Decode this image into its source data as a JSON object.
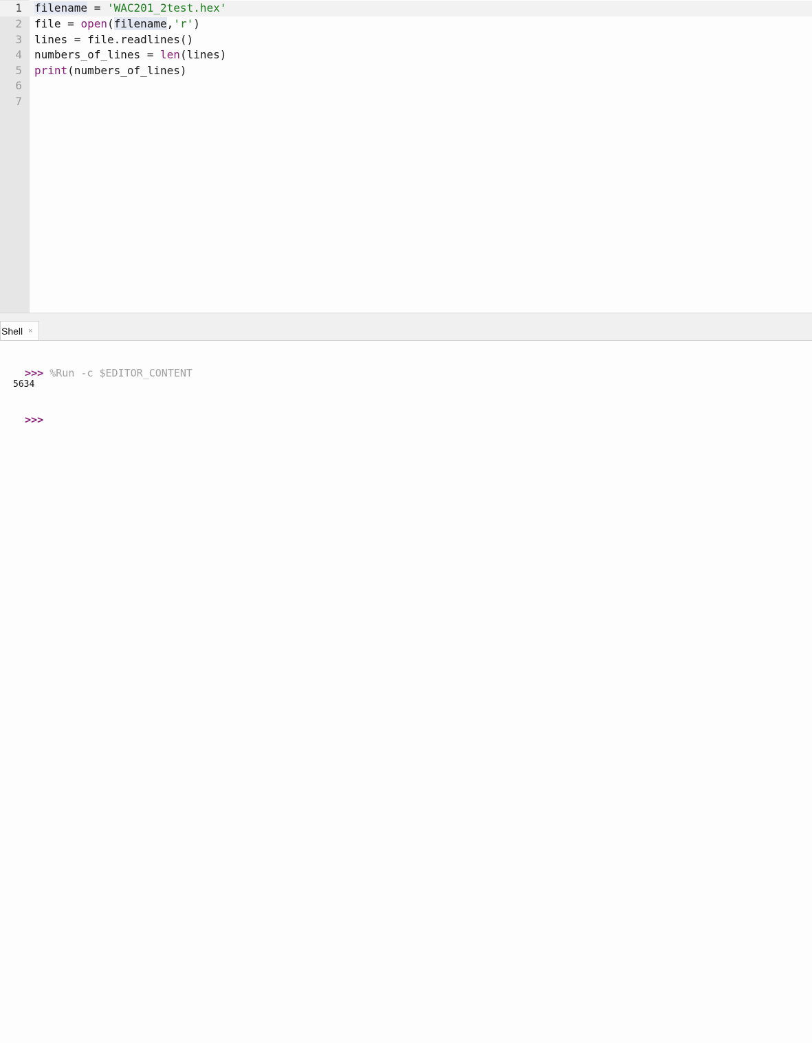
{
  "editor": {
    "lines": [
      {
        "num": "1",
        "parts": [
          "filename",
          " = ",
          "'WAC201_2test.hex'"
        ]
      },
      {
        "num": "2",
        "parts": [
          "file = ",
          "open",
          "(",
          "filename",
          ",",
          "'r'",
          ")"
        ]
      },
      {
        "num": "3",
        "text": "lines = file.readlines()"
      },
      {
        "num": "4",
        "parts": [
          "numbers_of_lines = ",
          "len",
          "(lines)"
        ]
      },
      {
        "num": "5",
        "parts": [
          "print",
          "(numbers_of_lines)"
        ]
      },
      {
        "num": "6",
        "text": ""
      },
      {
        "num": "7",
        "text": ""
      }
    ]
  },
  "shell_tab": {
    "label": "Shell",
    "close": "×"
  },
  "shell": {
    "prompt": ">>>",
    "command": "%Run -c $EDITOR_CONTENT",
    "output": "5634",
    "final_prompt": ">>>"
  }
}
